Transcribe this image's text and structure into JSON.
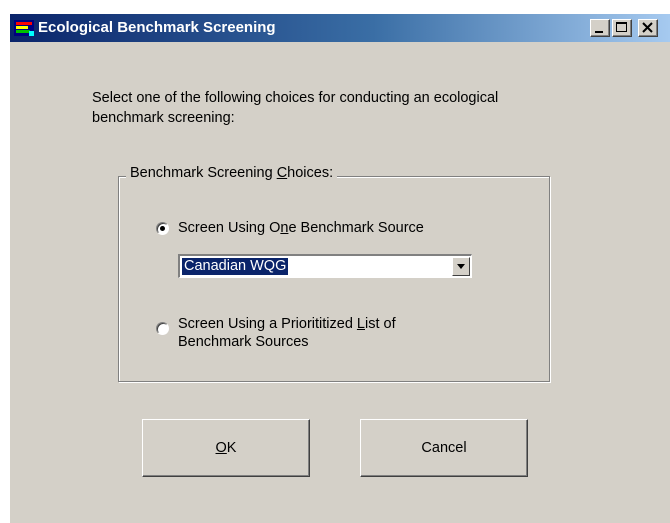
{
  "window": {
    "title": "Ecological Benchmark Screening",
    "icon": "app-icon",
    "controls": [
      "minimize-icon",
      "maximize-icon",
      "close-icon"
    ]
  },
  "prompt": {
    "line1": "Select one of the following choices for conducting an ecological",
    "line2": "benchmark screening:"
  },
  "group": {
    "legend_pre": "Benchmark Screening ",
    "legend_accel": "C",
    "legend_post": "hoices:"
  },
  "options": [
    {
      "label_pre": "Screen Using O",
      "label_accel": "n",
      "label_post": "e Benchmark Source",
      "selected": true
    },
    {
      "label_line1_pre": "Screen Using a Priorititized ",
      "label_line1_accel": "L",
      "label_line1_post": "ist of",
      "label_line2": "Benchmark Sources",
      "selected": false
    }
  ],
  "benchmark_source": {
    "selected": "Canadian WQG"
  },
  "buttons": {
    "ok_accel": "O",
    "ok_post": "K",
    "cancel": "Cancel"
  },
  "colors": {
    "face": "#d4d0c8",
    "title_start": "#0a246a",
    "title_end": "#a6caf0",
    "selection": "#0a246a"
  }
}
